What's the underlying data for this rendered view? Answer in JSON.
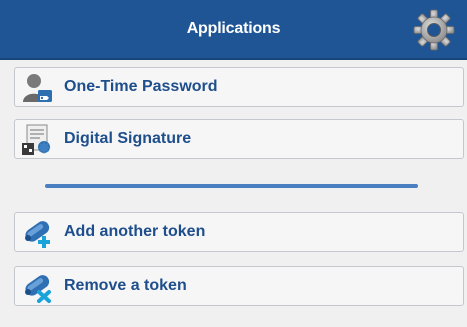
{
  "header": {
    "title": "Applications",
    "settings_icon": "gear-icon"
  },
  "menu": {
    "items": [
      {
        "label": "One-Time Password",
        "icon": "user-key-icon"
      },
      {
        "label": "Digital Signature",
        "icon": "certificate-icon"
      },
      {
        "label": "Add another token",
        "icon": "token-add-icon"
      },
      {
        "label": "Remove a token",
        "icon": "token-remove-icon"
      }
    ]
  },
  "colors": {
    "header_bg": "#1f5595",
    "label_text": "#1f4e8c",
    "divider": "#4a7fc1",
    "background": "#f0f0f1"
  }
}
